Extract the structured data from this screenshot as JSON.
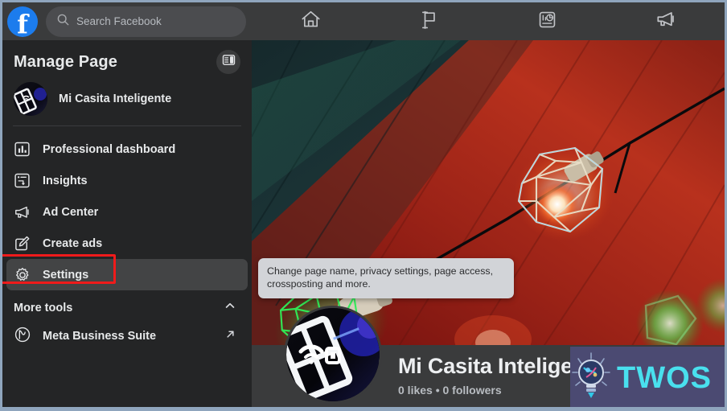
{
  "topbar": {
    "logo_icon": "facebook-logo-icon",
    "search": {
      "icon": "search-icon",
      "placeholder": "Search Facebook",
      "value": ""
    },
    "nav": [
      {
        "icon": "home-icon",
        "name": "nav-home"
      },
      {
        "icon": "flag-pages-icon",
        "name": "nav-pages"
      },
      {
        "icon": "insights-dashboard-icon",
        "name": "nav-insights"
      },
      {
        "icon": "megaphone-ads-icon",
        "name": "nav-ads"
      }
    ]
  },
  "sidebar": {
    "title": "Manage Page",
    "collapse_icon": "panel-toggle-icon",
    "page": {
      "name": "Mi Casita Inteligente",
      "avatar_icon": "page-avatar"
    },
    "items": [
      {
        "label": "Professional dashboard",
        "icon": "bar-chart-icon",
        "hovered": false
      },
      {
        "label": "Insights",
        "icon": "insights-panel-icon",
        "hovered": false
      },
      {
        "label": "Ad Center",
        "icon": "megaphone-icon",
        "hovered": false
      },
      {
        "label": "Create ads",
        "icon": "pencil-compose-icon",
        "hovered": false
      },
      {
        "label": "Settings",
        "icon": "gear-icon",
        "hovered": true
      }
    ],
    "more_tools": {
      "label": "More tools",
      "chevron_icon": "chevron-up-icon",
      "items": [
        {
          "label": "Meta Business Suite",
          "icon": "meta-infinity-icon",
          "external_icon": "external-link-icon"
        }
      ]
    },
    "highlight_color": "#ef1b1b"
  },
  "main": {
    "cover_photo": {
      "alt": "String lights with geometric wire cage shades, green and red glowing bulbs on a red wall"
    },
    "tooltip": {
      "text": "Change page name, privacy settings, page access, crossposting and more."
    },
    "profile": {
      "name": "Mi Casita Inteligente",
      "stats": "0 likes • 0 followers",
      "camera_icon": "camera-icon",
      "avatar_icon": "profile-avatar"
    }
  },
  "watermark": {
    "text": "TWOS",
    "logo_icon": "lightbulb-icon",
    "background_color": "#4b4a72",
    "text_color": "#49e0ee"
  }
}
